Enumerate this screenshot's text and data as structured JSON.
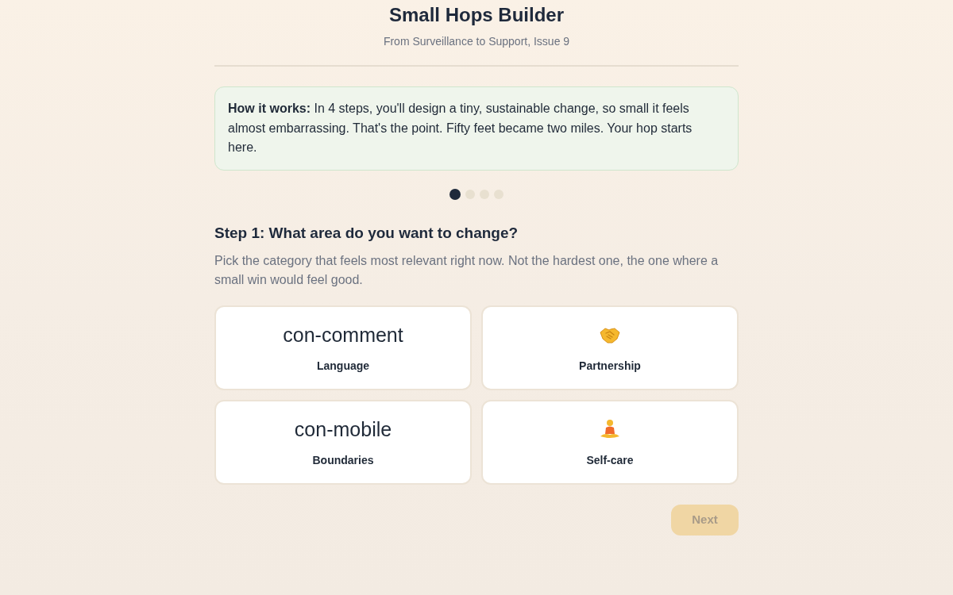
{
  "header": {
    "title": "Small Hops Builder",
    "subtitle": "From Surveillance to Support, Issue 9"
  },
  "intro": {
    "text": "**How it works:** In 4 steps, you'll design a tiny, sustainable change, so small it feels almost embarrassing. That's the point. Fifty feet became two miles. Your hop starts here."
  },
  "steps": [
    {
      "selected": true
    },
    {
      "selected": false
    },
    {
      "selected": false
    },
    {
      "selected": false
    }
  ],
  "question": {
    "title": "Step 1: What area do you want to change?",
    "description": "Pick the category that feels most relevant right now. Not the hardest one, the one where a small win would feel good."
  },
  "categories": [
    {
      "kind": "label",
      "icon_text": "con-comment",
      "label": "Language",
      "selected": false
    },
    {
      "kind": "handshake",
      "label": "Partnership",
      "selected": false
    },
    {
      "kind": "label",
      "icon_text": "con-mobile",
      "label": "Boundaries",
      "selected": false
    },
    {
      "kind": "lotus",
      "label": "Self-care",
      "selected": false
    }
  ],
  "next_button": {
    "label": "Next",
    "disabled": true
  }
}
